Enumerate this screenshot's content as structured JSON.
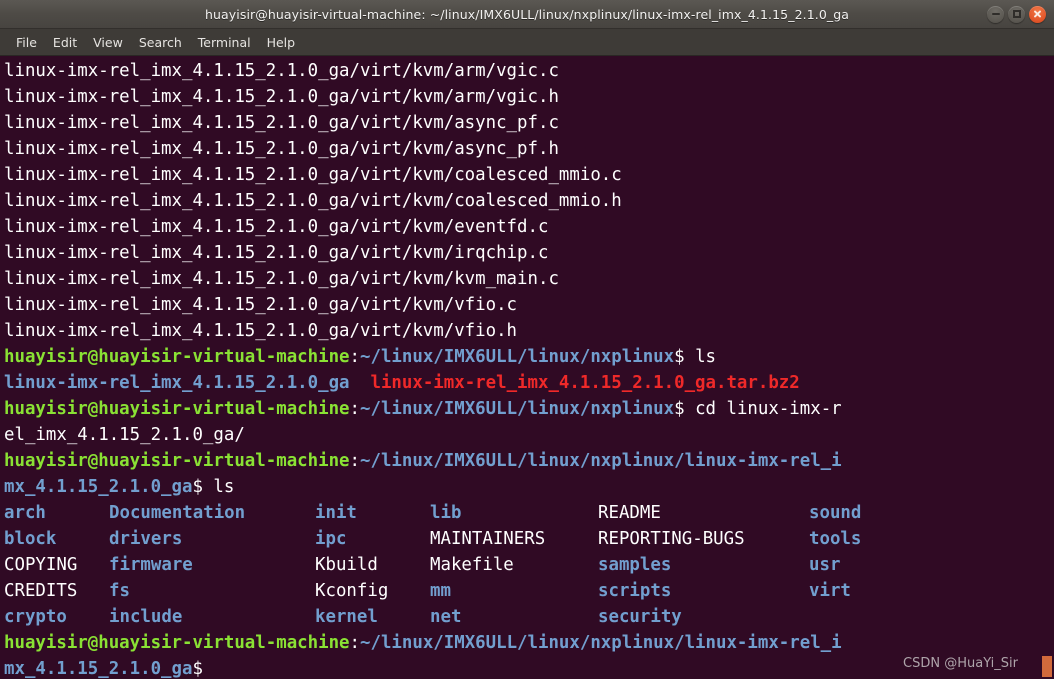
{
  "window": {
    "title": "huayisir@huayisir-virtual-machine: ~/linux/IMX6ULL/linux/nxplinux/linux-imx-rel_imx_4.1.15_2.1.0_ga",
    "controls": {
      "minimize_label": "Minimize",
      "maximize_label": "Maximize",
      "close_label": "Close"
    }
  },
  "menubar": {
    "items": [
      {
        "label": "File"
      },
      {
        "label": "Edit"
      },
      {
        "label": "View"
      },
      {
        "label": "Search"
      },
      {
        "label": "Terminal"
      },
      {
        "label": "Help"
      }
    ]
  },
  "colors": {
    "terminal_background": "#300a24",
    "titlebar_background": "#4e4b46",
    "menubar_background": "#3e3b37",
    "text_white": "#ffffff",
    "prompt_green": "#8ae234",
    "path_blue": "#729fcf",
    "directory_blue": "#729fcf",
    "archive_red": "#ef2929",
    "cursor": "#d26a3c"
  },
  "terminal": {
    "extracted_files": [
      "linux-imx-rel_imx_4.1.15_2.1.0_ga/virt/kvm/arm/vgic.c",
      "linux-imx-rel_imx_4.1.15_2.1.0_ga/virt/kvm/arm/vgic.h",
      "linux-imx-rel_imx_4.1.15_2.1.0_ga/virt/kvm/async_pf.c",
      "linux-imx-rel_imx_4.1.15_2.1.0_ga/virt/kvm/async_pf.h",
      "linux-imx-rel_imx_4.1.15_2.1.0_ga/virt/kvm/coalesced_mmio.c",
      "linux-imx-rel_imx_4.1.15_2.1.0_ga/virt/kvm/coalesced_mmio.h",
      "linux-imx-rel_imx_4.1.15_2.1.0_ga/virt/kvm/eventfd.c",
      "linux-imx-rel_imx_4.1.15_2.1.0_ga/virt/kvm/irqchip.c",
      "linux-imx-rel_imx_4.1.15_2.1.0_ga/virt/kvm/kvm_main.c",
      "linux-imx-rel_imx_4.1.15_2.1.0_ga/virt/kvm/vfio.c",
      "linux-imx-rel_imx_4.1.15_2.1.0_ga/virt/kvm/vfio.h"
    ],
    "prompt1": {
      "user_host": "huayisir@huayisir-virtual-machine",
      "separator": ":",
      "path": "~/linux/IMX6ULL/linux/nxplinux",
      "dollar": "$ ",
      "command": "ls"
    },
    "ls_result1": {
      "directory": "linux-imx-rel_imx_4.1.15_2.1.0_ga",
      "gap": "  ",
      "archive": "linux-imx-rel_imx_4.1.15_2.1.0_ga.tar.bz2"
    },
    "prompt2": {
      "user_host": "huayisir@huayisir-virtual-machine",
      "separator": ":",
      "path": "~/linux/IMX6ULL/linux/nxplinux",
      "dollar": "$ ",
      "command_part1": "cd linux-imx-r",
      "command_part2": "el_imx_4.1.15_2.1.0_ga/"
    },
    "prompt3": {
      "user_host": "huayisir@huayisir-virtual-machine",
      "separator": ":",
      "path_part1": "~/linux/IMX6ULL/linux/nxplinux/linux-imx-rel_i",
      "path_part2": "mx_4.1.15_2.1.0_ga",
      "dollar": "$ ",
      "command": "ls"
    },
    "ls_result2": {
      "rows": [
        [
          {
            "name": "arch",
            "type": "dir"
          },
          {
            "name": "Documentation",
            "type": "dir"
          },
          {
            "name": "init",
            "type": "dir"
          },
          {
            "name": "lib",
            "type": "dir"
          },
          {
            "name": "README",
            "type": "file"
          },
          {
            "name": "sound",
            "type": "dir"
          }
        ],
        [
          {
            "name": "block",
            "type": "dir"
          },
          {
            "name": "drivers",
            "type": "dir"
          },
          {
            "name": "ipc",
            "type": "dir"
          },
          {
            "name": "MAINTAINERS",
            "type": "file"
          },
          {
            "name": "REPORTING-BUGS",
            "type": "file"
          },
          {
            "name": "tools",
            "type": "dir"
          }
        ],
        [
          {
            "name": "COPYING",
            "type": "file"
          },
          {
            "name": "firmware",
            "type": "dir"
          },
          {
            "name": "Kbuild",
            "type": "file"
          },
          {
            "name": "Makefile",
            "type": "file"
          },
          {
            "name": "samples",
            "type": "dir"
          },
          {
            "name": "usr",
            "type": "dir"
          }
        ],
        [
          {
            "name": "CREDITS",
            "type": "file"
          },
          {
            "name": "fs",
            "type": "dir"
          },
          {
            "name": "Kconfig",
            "type": "file"
          },
          {
            "name": "mm",
            "type": "dir"
          },
          {
            "name": "scripts",
            "type": "dir"
          },
          {
            "name": "virt",
            "type": "dir"
          }
        ],
        [
          {
            "name": "crypto",
            "type": "dir"
          },
          {
            "name": "include",
            "type": "dir"
          },
          {
            "name": "kernel",
            "type": "dir"
          },
          {
            "name": "net",
            "type": "dir"
          },
          {
            "name": "security",
            "type": "dir"
          },
          {
            "name": "",
            "type": "dir"
          }
        ]
      ]
    },
    "prompt4": {
      "user_host": "huayisir@huayisir-virtual-machine",
      "separator": ":",
      "path_part1": "~/linux/IMX6ULL/linux/nxplinux/linux-imx-rel_i",
      "path_part2": "mx_4.1.15_2.1.0_ga",
      "dollar": "$"
    }
  },
  "watermark": {
    "text": "CSDN @HuaYi_Sir"
  }
}
